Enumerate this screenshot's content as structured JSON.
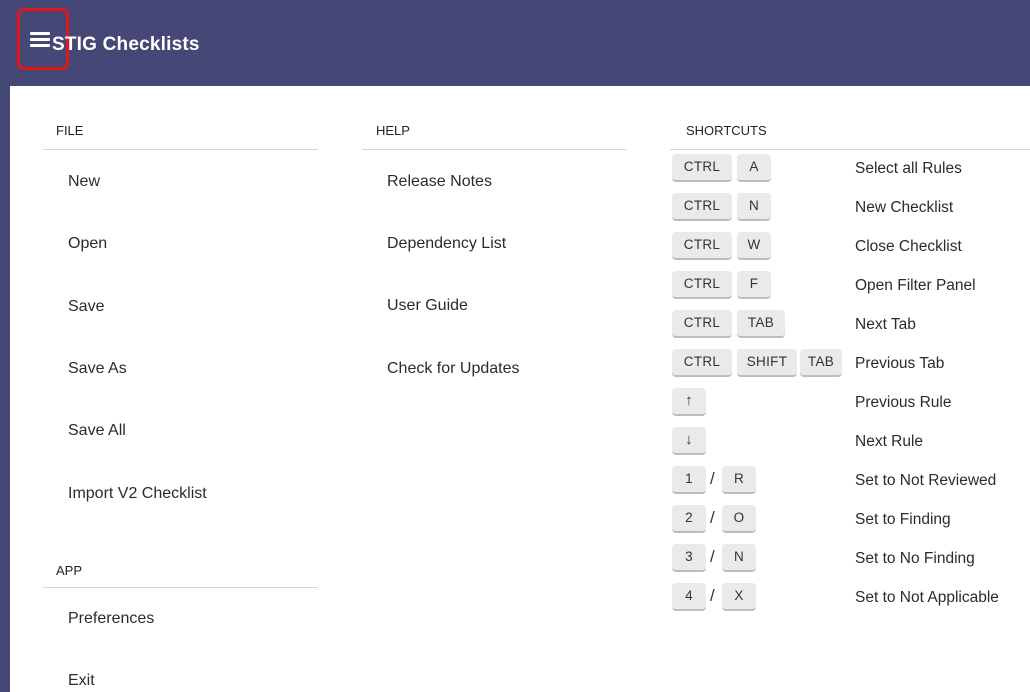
{
  "header": {
    "title": "STIG Checklists",
    "menu_icon": "hamburger-menu-icon"
  },
  "file": {
    "heading": "FILE",
    "items": [
      "New",
      "Open",
      "Save",
      "Save As",
      "Save All",
      "Import V2 Checklist"
    ]
  },
  "app": {
    "heading": "APP",
    "items": [
      "Preferences",
      "Exit"
    ]
  },
  "help": {
    "heading": "HELP",
    "items": [
      "Release Notes",
      "Dependency List",
      "User Guide",
      "Check for Updates"
    ]
  },
  "shortcuts": {
    "heading": "SHORTCUTS",
    "rows": [
      {
        "keys": [
          "CTRL",
          "A"
        ],
        "label": "Select all Rules"
      },
      {
        "keys": [
          "CTRL",
          "N"
        ],
        "label": "New Checklist"
      },
      {
        "keys": [
          "CTRL",
          "W"
        ],
        "label": "Close Checklist"
      },
      {
        "keys": [
          "CTRL",
          "F"
        ],
        "label": "Open Filter Panel"
      },
      {
        "keys": [
          "CTRL",
          "TAB"
        ],
        "label": "Next Tab"
      },
      {
        "keys": [
          "CTRL",
          "SHIFT",
          "TAB"
        ],
        "label": "Previous Tab"
      },
      {
        "keys": [
          "↑"
        ],
        "label": "Previous Rule"
      },
      {
        "keys": [
          "↓"
        ],
        "label": "Next Rule"
      },
      {
        "keys": [
          "1",
          "R"
        ],
        "label": "Set to Not Reviewed"
      },
      {
        "keys": [
          "2",
          "O"
        ],
        "label": "Set to Finding"
      },
      {
        "keys": [
          "3",
          "N"
        ],
        "label": "Set to No Finding"
      },
      {
        "keys": [
          "4",
          "X"
        ],
        "label": "Set to Not Applicable"
      }
    ],
    "separator": "/"
  },
  "colors": {
    "header_bg": "#454776",
    "highlight": "#e8141c",
    "key_bg": "#eaeaea"
  }
}
